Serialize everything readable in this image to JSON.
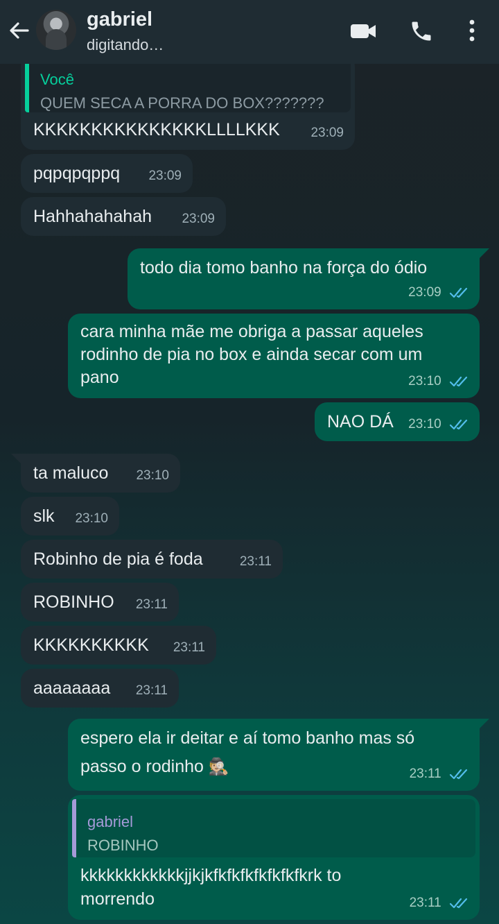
{
  "header": {
    "contact_name": "gabriel",
    "status": "digitando…",
    "icons": [
      "back-arrow-icon",
      "video-call-icon",
      "phone-call-icon",
      "more-options-icon"
    ]
  },
  "messages": [
    {
      "dir": "in",
      "quote": {
        "author": "Você",
        "text": "QUEM SECA A PORRA DO BOX???????"
      },
      "text": "KKKKKKKKKKKKKKKLLLLKKK",
      "time": "23:09"
    },
    {
      "dir": "in",
      "text": "pqpqpqppq",
      "time": "23:09"
    },
    {
      "dir": "in",
      "text": "Hahhahahahah",
      "time": "23:09"
    },
    {
      "dir": "out",
      "text": "todo dia tomo banho na força do ódio",
      "time": "23:09",
      "status": "read"
    },
    {
      "dir": "out",
      "lines": [
        "cara minha mãe me obriga a passar aqueles",
        "rodinho de pia no box e ainda secar com um",
        "pano"
      ],
      "time": "23:10",
      "status": "read"
    },
    {
      "dir": "out",
      "text": "NAO DÁ",
      "time": "23:10",
      "status": "read"
    },
    {
      "dir": "in",
      "text": "ta maluco",
      "time": "23:10"
    },
    {
      "dir": "in",
      "text": "slk",
      "time": "23:10"
    },
    {
      "dir": "in",
      "text": "Robinho de pia é foda",
      "time": "23:11"
    },
    {
      "dir": "in",
      "text": "ROBINHO",
      "time": "23:11"
    },
    {
      "dir": "in",
      "text": "KKKKKKKKKK",
      "time": "23:11"
    },
    {
      "dir": "in",
      "text": "aaaaaaaa",
      "time": "23:11"
    },
    {
      "dir": "out",
      "lines": [
        "espero ela ir deitar e aí tomo banho mas só",
        "passo o rodinho"
      ],
      "emoji": "🕵🏼",
      "time": "23:11",
      "status": "read"
    },
    {
      "dir": "out",
      "quote": {
        "author": "gabriel",
        "text": "ROBINHO"
      },
      "lines": [
        "kkkkkkkkkkkkjjkjkfkfkfkfkfkfkfkrk to",
        "morrendo"
      ],
      "time": "23:11",
      "status": "read"
    }
  ],
  "colors": {
    "incoming_bubble": "#1f2c33",
    "outgoing_bubble": "#005c4b",
    "read_ticks": "#53bdeb",
    "quote_you": "#06cf9c",
    "quote_gabriel": "#a59ad8"
  }
}
